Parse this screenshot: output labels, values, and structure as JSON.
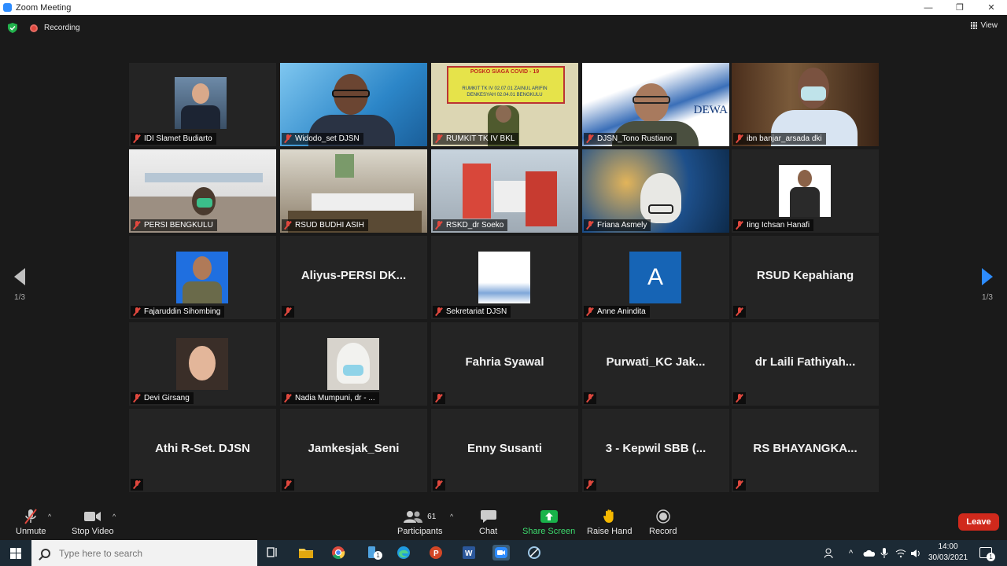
{
  "window": {
    "title": "Zoom Meeting",
    "minimize": "—",
    "maximize": "❐",
    "close": "✕"
  },
  "top": {
    "recording": "Recording",
    "view": "View"
  },
  "pager": {
    "left": "1/3",
    "right": "1/3"
  },
  "tiles": [
    {
      "name": "IDI Slamet Budiarto",
      "big": ""
    },
    {
      "name": "Widodo_set DJSN",
      "big": ""
    },
    {
      "name": "RUMKIT TK IV BKL",
      "big": ""
    },
    {
      "name": "DJSN_Tono Rustiano",
      "big": ""
    },
    {
      "name": "ibn banjar_arsada dki",
      "big": ""
    },
    {
      "name": "PERSI BENGKULU",
      "big": ""
    },
    {
      "name": "RSUD BUDHI ASIH",
      "big": ""
    },
    {
      "name": "RSKD_dr Soeko",
      "big": ""
    },
    {
      "name": "Friana Asmely",
      "big": ""
    },
    {
      "name": "Iing Ichsan Hanafi",
      "big": ""
    },
    {
      "name": "Fajaruddin Sihombing",
      "big": ""
    },
    {
      "name": "",
      "big": "Aliyus-PERSI  DK..."
    },
    {
      "name": "Sekretariat DJSN",
      "big": ""
    },
    {
      "name": "Anne Anindita",
      "big": "",
      "avatar_letter": "A"
    },
    {
      "name": "",
      "big": "RSUD Kepahiang"
    },
    {
      "name": "Devi Girsang",
      "big": ""
    },
    {
      "name": "Nadia Mumpuni, dr - ...",
      "big": ""
    },
    {
      "name": "",
      "big": "Fahria Syawal"
    },
    {
      "name": "",
      "big": "Purwati_KC Jak..."
    },
    {
      "name": "",
      "big": "dr  Laili  Fathiyah..."
    },
    {
      "name": "",
      "big": "Athi R-Set. DJSN"
    },
    {
      "name": "",
      "big": "Jamkesjak_Seni"
    },
    {
      "name": "",
      "big": "Enny Susanti"
    },
    {
      "name": "",
      "big": "3  -  Kepwil SBB  (..."
    },
    {
      "name": "",
      "big": "RS  BHAYANGKA..."
    }
  ],
  "video_texts": {
    "rumkit_banner": "POSKO SIAGA COVID - 19",
    "rumkit_line1": "RUMKIT TK IV 02.07.01 ZAINUL ARIFIN",
    "rumkit_line2": "DENKESYAH 02.04.01 BENGKULU",
    "dewan": "DEWA"
  },
  "toolbar": {
    "unmute": "Unmute",
    "stop_video": "Stop Video",
    "participants": "Participants",
    "participants_count": "61",
    "chat": "Chat",
    "share_screen": "Share Screen",
    "raise_hand": "Raise Hand",
    "record": "Record",
    "leave": "Leave"
  },
  "taskbar": {
    "search_placeholder": "Type here to search",
    "time": "14:00",
    "date": "30/03/2021",
    "notif_count": "1",
    "word_badge": "1"
  },
  "colors": {
    "accent": "#2D8CFF",
    "active_speaker": "#a7e24d",
    "leave": "#d0291c",
    "share": "#19b34a"
  }
}
